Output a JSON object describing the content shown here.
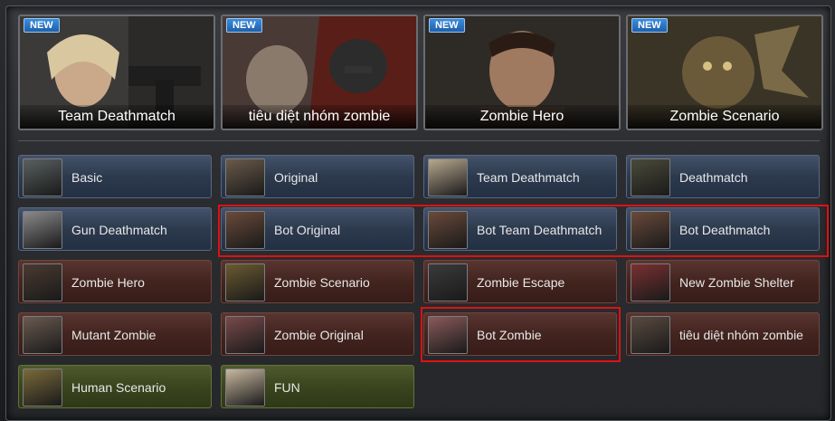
{
  "close_glyph": "×",
  "badge_text": "NEW",
  "banners": [
    {
      "label": "Team Deathmatch"
    },
    {
      "label": "tiêu diệt nhóm zombie"
    },
    {
      "label": "Zombie Hero"
    },
    {
      "label": "Zombie Scenario"
    }
  ],
  "modes": [
    {
      "label": "Basic",
      "color": "blue"
    },
    {
      "label": "Original",
      "color": "blue"
    },
    {
      "label": "Team Deathmatch",
      "color": "blue"
    },
    {
      "label": "Deathmatch",
      "color": "blue"
    },
    {
      "label": "Gun Deathmatch",
      "color": "blue"
    },
    {
      "label": "Bot Original",
      "color": "blue"
    },
    {
      "label": "Bot Team Deathmatch",
      "color": "blue"
    },
    {
      "label": "Bot Deathmatch",
      "color": "blue"
    },
    {
      "label": "Zombie Hero",
      "color": "red"
    },
    {
      "label": "Zombie Scenario",
      "color": "red"
    },
    {
      "label": "Zombie Escape",
      "color": "red"
    },
    {
      "label": "New Zombie Shelter",
      "color": "red"
    },
    {
      "label": "Mutant Zombie",
      "color": "red"
    },
    {
      "label": "Zombie Original",
      "color": "red"
    },
    {
      "label": "Bot Zombie",
      "color": "red"
    },
    {
      "label": "tiêu diệt nhóm zombie",
      "color": "red"
    },
    {
      "label": "Human Scenario",
      "color": "green"
    },
    {
      "label": "FUN",
      "color": "green"
    }
  ]
}
